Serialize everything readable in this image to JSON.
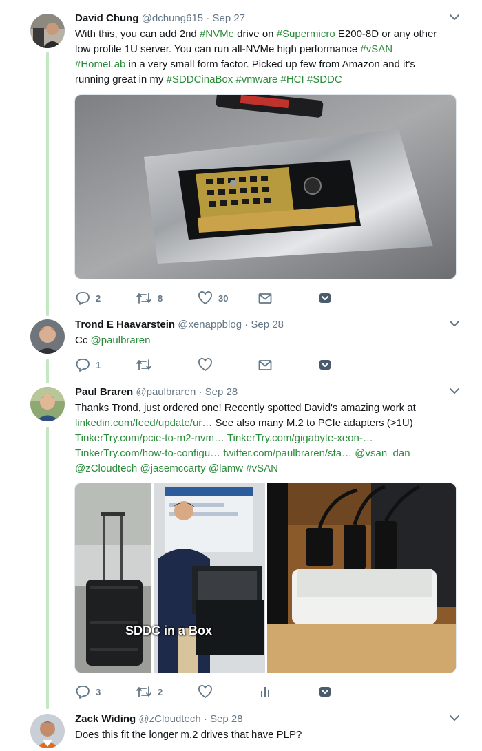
{
  "tweets": [
    {
      "name": "David Chung",
      "handle": "@dchung615",
      "separator": "·",
      "time": "Sep 27",
      "lines": [
        [
          {
            "t": "With this, you can add 2nd "
          },
          {
            "t": "#NVMe",
            "link": true
          },
          {
            "t": " drive on "
          },
          {
            "t": "#Supermicro",
            "link": true
          },
          {
            "t": " E200-8D or any other"
          }
        ],
        [
          {
            "t": "low profile 1U server.  You can run all-NVMe high performance "
          },
          {
            "t": "#vSAN",
            "link": true
          }
        ],
        [
          {
            "t": "#HomeLab",
            "link": true
          },
          {
            "t": " in a very small form factor. Picked up few from Amazon and it's"
          }
        ],
        [
          {
            "t": "running great in my "
          },
          {
            "t": "#SDDCinaBox",
            "link": true
          },
          {
            "t": " "
          },
          {
            "t": "#vmware",
            "link": true
          },
          {
            "t": " "
          },
          {
            "t": "#HCI",
            "link": true
          },
          {
            "t": " "
          },
          {
            "t": "#SDDC",
            "link": true
          }
        ]
      ],
      "replies": "2",
      "retweets": "8",
      "likes": "30"
    },
    {
      "name": "Trond E Haavarstein",
      "handle": "@xenappblog",
      "separator": "·",
      "time": "Sep 28",
      "lines": [
        [
          {
            "t": "Cc "
          },
          {
            "t": "@paulbraren",
            "link": true
          }
        ]
      ],
      "replies": "1",
      "retweets": "",
      "likes": ""
    },
    {
      "name": "Paul Braren",
      "handle": "@paulbraren",
      "separator": "·",
      "time": "Sep 28",
      "lines": [
        [
          {
            "t": "Thanks Trond, just ordered one! Recently spotted David's amazing work at"
          }
        ],
        [
          {
            "t": "linkedin.com/feed/update/ur…",
            "link": true
          },
          {
            "t": " See also many M.2 to PCIe adapters (>1U)"
          }
        ],
        [
          {
            "t": "TinkerTry.com/pcie-to-m2-nvm…",
            "link": true
          },
          {
            "t": " "
          },
          {
            "t": "TinkerTry.com/gigabyte-xeon-…",
            "link": true
          }
        ],
        [
          {
            "t": "TinkerTry.com/how-to-configu…",
            "link": true
          },
          {
            "t": " "
          },
          {
            "t": "twitter.com/paulbraren/sta…",
            "link": true
          },
          {
            "t": " "
          },
          {
            "t": "@vsan_dan",
            "link": true
          }
        ],
        [
          {
            "t": "@zCloudtech",
            "link": true
          },
          {
            "t": " "
          },
          {
            "t": "@jasemccarty",
            "link": true
          },
          {
            "t": " "
          },
          {
            "t": "@lamw",
            "link": true
          },
          {
            "t": " "
          },
          {
            "t": "#vSAN",
            "link": true
          }
        ]
      ],
      "media_caption": "SDDC in a Box",
      "replies": "3",
      "retweets": "2",
      "likes": ""
    },
    {
      "name": "Zack Widing",
      "handle": "@zCloudtech",
      "separator": "·",
      "time": "Sep 28",
      "lines": [
        [
          {
            "t": "Does this fit the longer m.2 drives that have PLP?"
          }
        ]
      ]
    }
  ],
  "icons": {
    "reply": "reply-icon",
    "retweet": "retweet-icon",
    "like": "heart-icon",
    "message": "envelope-icon",
    "analytics": "analytics-icon",
    "more": "chevron-down-icon"
  },
  "colors": {
    "link": "#2a8c3a",
    "thread_line": "#c4e7c4",
    "muted": "#657786",
    "action_icon": "#657786",
    "bookmark": "#4a5b6c"
  }
}
